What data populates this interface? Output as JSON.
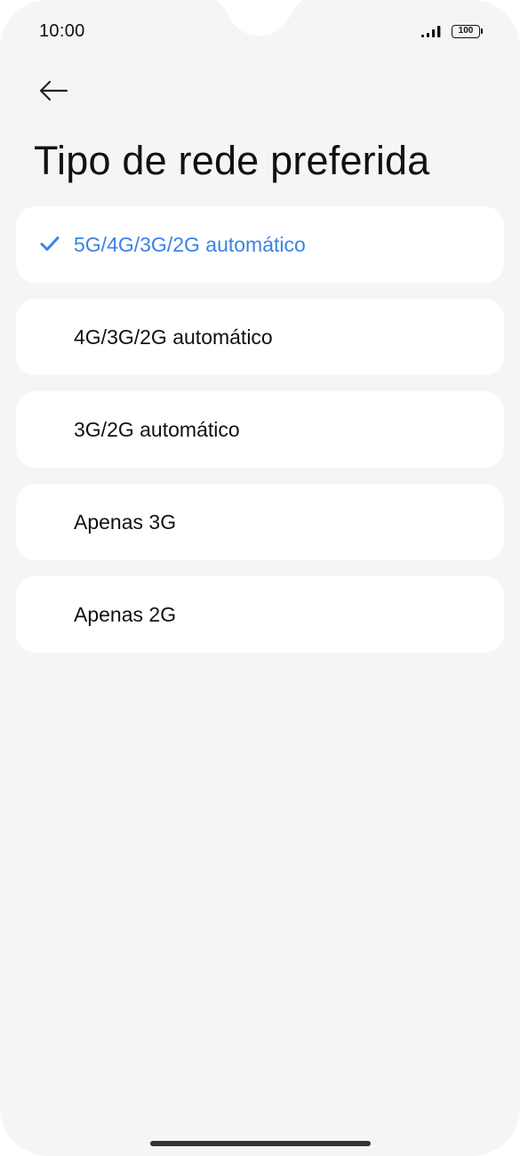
{
  "status_bar": {
    "time": "10:00",
    "battery": "100",
    "signal_icon": "signal-bars-icon"
  },
  "header": {
    "back_icon": "arrow-left-icon",
    "title": "Tipo de rede preferida"
  },
  "options": [
    {
      "label": "5G/4G/3G/2G automático",
      "selected": true
    },
    {
      "label": "4G/3G/2G automático",
      "selected": false
    },
    {
      "label": "3G/2G automático",
      "selected": false
    },
    {
      "label": "Apenas 3G",
      "selected": false
    },
    {
      "label": "Apenas 2G",
      "selected": false
    }
  ],
  "colors": {
    "accent": "#3c82e6",
    "background": "#f5f5f5",
    "card": "#ffffff",
    "text": "#111111"
  }
}
